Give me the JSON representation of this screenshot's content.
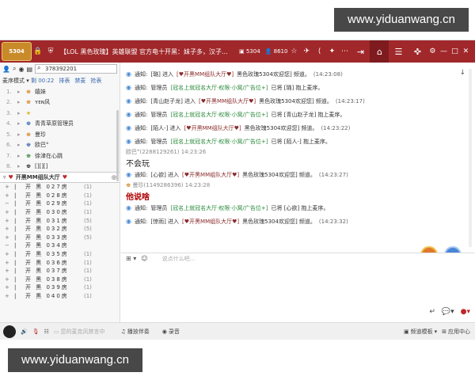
{
  "watermarks": [
    "www.yiduanwang.cn",
    "www.yiduanwang.cn"
  ],
  "titlebar": {
    "logo_text": "5304",
    "title": "【LOL 黑色玫瑰】英雄联盟 官方电十开黑：妹子多，汉子...",
    "channel_id": "5304",
    "online_count": "8610"
  },
  "search": {
    "value": "378392201"
  },
  "mode": {
    "label": "麦序模式",
    "timer": "剩 00:22",
    "links": [
      "排表",
      "禁麦",
      "抢表"
    ]
  },
  "ranking": [
    {
      "num": "1.",
      "name": "嬉妹"
    },
    {
      "num": "2.",
      "name": "ʏᴇɴ风"
    },
    {
      "num": "3.",
      "name": ""
    },
    {
      "num": "4.",
      "name": "青青草原管理员"
    },
    {
      "num": "5.",
      "name": "曼珍"
    },
    {
      "num": "6.",
      "name": "欧巴°"
    },
    {
      "num": "7.",
      "name": "徐津在心跳"
    },
    {
      "num": "8.",
      "name": "[][][]"
    }
  ],
  "channel_header": "开黑MM组队大厅",
  "rooms": [
    {
      "name": "开 黑 027房",
      "count": "(1)"
    },
    {
      "name": "开 黑 028房",
      "count": "(1)"
    },
    {
      "name": "开 黑 029房",
      "count": "(1)"
    },
    {
      "name": "开 黑 030房",
      "count": "(1)"
    },
    {
      "name": "开 黑 031房",
      "count": "(5)"
    },
    {
      "name": "开 黑 032房",
      "count": "(5)"
    },
    {
      "name": "开 黑 033房",
      "count": "(5)"
    },
    {
      "name": "开 黑 034房",
      "count": ""
    },
    {
      "name": "开 黑 035房",
      "count": "(1)"
    },
    {
      "name": "开 黑 036房",
      "count": "(1)"
    },
    {
      "name": "开 黑 037房",
      "count": "(1)"
    },
    {
      "name": "开 黑 038房",
      "count": "(1)"
    },
    {
      "name": "开 黑 039房",
      "count": "(1)"
    },
    {
      "name": "开 黑 040房",
      "count": "(1)"
    }
  ],
  "messages": [
    {
      "a": "通知:",
      "b": "[璐] 进入",
      "c": "[♥开黑MM组队大厅♥]",
      "d": "黑色玫瑰5304欢迎您] 频道。",
      "time": "(14:23:08)"
    },
    {
      "a": "通知:",
      "b": "管理员",
      "c": "[冠名上就冠名大厅·权限·小窝/广告位+]",
      "d": "已将 [璐] 抱上麦序。",
      "time": ""
    },
    {
      "a": "通知:",
      "b": "[青山赵子龙] 进入",
      "c": "[♥开黑MM组队大厅♥]",
      "d": "黑色玫瑰5304欢迎您] 频道。",
      "time": "(14:23:17)"
    },
    {
      "a": "通知:",
      "b": "管理员",
      "c": "[冠名上就冠名大厅·权限·小窝/广告位+]",
      "d": "已将 [青山赵子龙] 抱上麦序。",
      "time": ""
    },
    {
      "a": "通知:",
      "b": "[陌人-] 进入",
      "c": "[♥开黑MM组队大厅♥]",
      "d": "黑色玫瑰5304欢迎您] 频道。",
      "time": "(14:23:22)"
    },
    {
      "a": "通知:",
      "b": "管理员",
      "c": "[冠名上就冠名大厅·权限·小窝/广告位+]",
      "d": "已将 [陌人-] 抱上麦序。",
      "time": ""
    }
  ],
  "user1": {
    "line": "欧巴°(2288129261)  14:23:26",
    "text": "不会玩"
  },
  "message7": {
    "a": "通知:",
    "b": "[心欲] 进入",
    "c": "[♥开黑MM组队大厅♥]",
    "d": "黑色玫瑰5304欢迎您] 频道。",
    "time": "(14:23:27)"
  },
  "user2": {
    "line": "曼珍(1149286396)  14:23:28",
    "text": "他说啥"
  },
  "messages2": [
    {
      "a": "通知:",
      "b": "管理员",
      "c": "[冠名上就冠名大厅·权限·小窝/广告位+]",
      "d": "已将 [心欲] 抱上麦序。",
      "time": ""
    },
    {
      "a": "通知:",
      "b": "[惊雨] 进入",
      "c": "[♥开黑MM组队大厅♥]",
      "d": "黑色玫瑰5304欢迎您] 频道。",
      "time": "(14:23:32)"
    }
  ],
  "input": {
    "placeholder": "说点什么吧..."
  },
  "bottom": {
    "mic_hint": "您的麦克风禁言中",
    "play_label": "播放伴奏",
    "record_label": "录音",
    "template_label": "频道模板",
    "app_center": "应用中心"
  },
  "colors": {
    "titlebar": "#a0282b",
    "accent_active": "#7d1b1e"
  }
}
